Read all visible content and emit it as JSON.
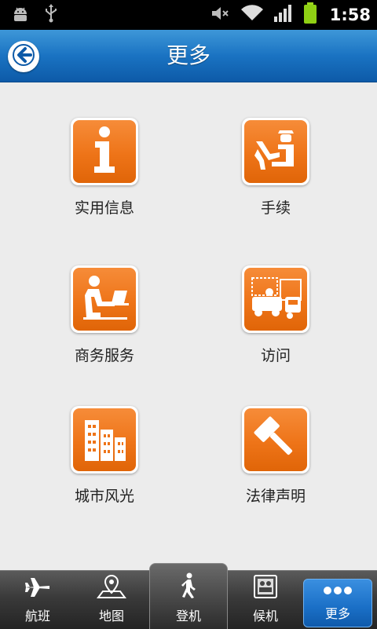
{
  "status_bar": {
    "time": "1:58",
    "icons": [
      "android-debug-icon",
      "usb-icon",
      "mute-icon",
      "wifi-icon",
      "signal-icon",
      "battery-icon"
    ]
  },
  "header": {
    "title": "更多",
    "back_icon": "back-arrow-icon"
  },
  "menu": {
    "items": [
      {
        "label": "实用信息",
        "icon": "info-icon"
      },
      {
        "label": "手续",
        "icon": "check-in-icon"
      },
      {
        "label": "商务服务",
        "icon": "business-laptop-icon"
      },
      {
        "label": "访问",
        "icon": "access-vehicles-icon"
      },
      {
        "label": "城市风光",
        "icon": "city-buildings-icon"
      },
      {
        "label": "法律声明",
        "icon": "legal-gavel-icon"
      }
    ]
  },
  "tabbar": {
    "tabs": [
      {
        "label": "航班",
        "icon": "airplane-icon"
      },
      {
        "label": "地图",
        "icon": "map-pin-icon"
      },
      {
        "label": "登机",
        "icon": "walking-person-icon"
      },
      {
        "label": "候机",
        "icon": "waiting-lounge-icon"
      },
      {
        "label": "更多",
        "icon": "more-dots-icon"
      }
    ],
    "active_tab": "更多"
  },
  "colors": {
    "title_bar": "#1a73c2",
    "tile_orange": "#ee7418",
    "active_tab": "#1a6fc6",
    "background": "#ececec"
  }
}
